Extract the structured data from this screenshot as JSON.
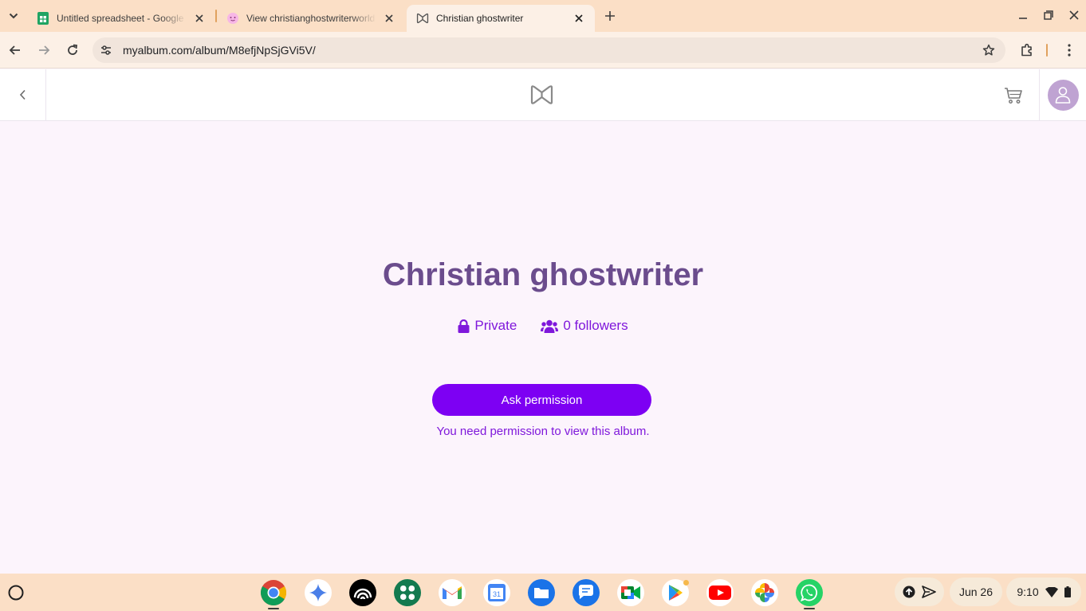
{
  "browser": {
    "tabs": [
      {
        "title": "Untitled spreadsheet - Google Sheets",
        "icon": "google-sheets-icon",
        "active": false
      },
      {
        "title": "View christianghostwriterworld",
        "icon": "pink-face-icon",
        "active": false
      },
      {
        "title": "Christian ghostwriter",
        "icon": "myalbum-logo-icon",
        "active": true
      }
    ],
    "url": "myalbum.com/album/M8efjNpSjGVi5V/"
  },
  "page": {
    "album_title": "Christian ghostwriter",
    "privacy": "Private",
    "followers": "0 followers",
    "ask_button": "Ask permission",
    "permission_note": "You need permission to view this album."
  },
  "shelf": {
    "apps": [
      "chrome",
      "gemini",
      "audible",
      "google-workspace",
      "gmail",
      "google-calendar",
      "files",
      "google-messages",
      "google-meet",
      "google-play",
      "youtube",
      "google-photos",
      "whatsapp"
    ],
    "date": "Jun 26",
    "time": "9:10"
  },
  "colors": {
    "chrome_frame": "#fbdfc6",
    "page_background": "#fcf4fc",
    "brand_purple": "#7d00f3",
    "title_purple": "#6b4c8d"
  }
}
